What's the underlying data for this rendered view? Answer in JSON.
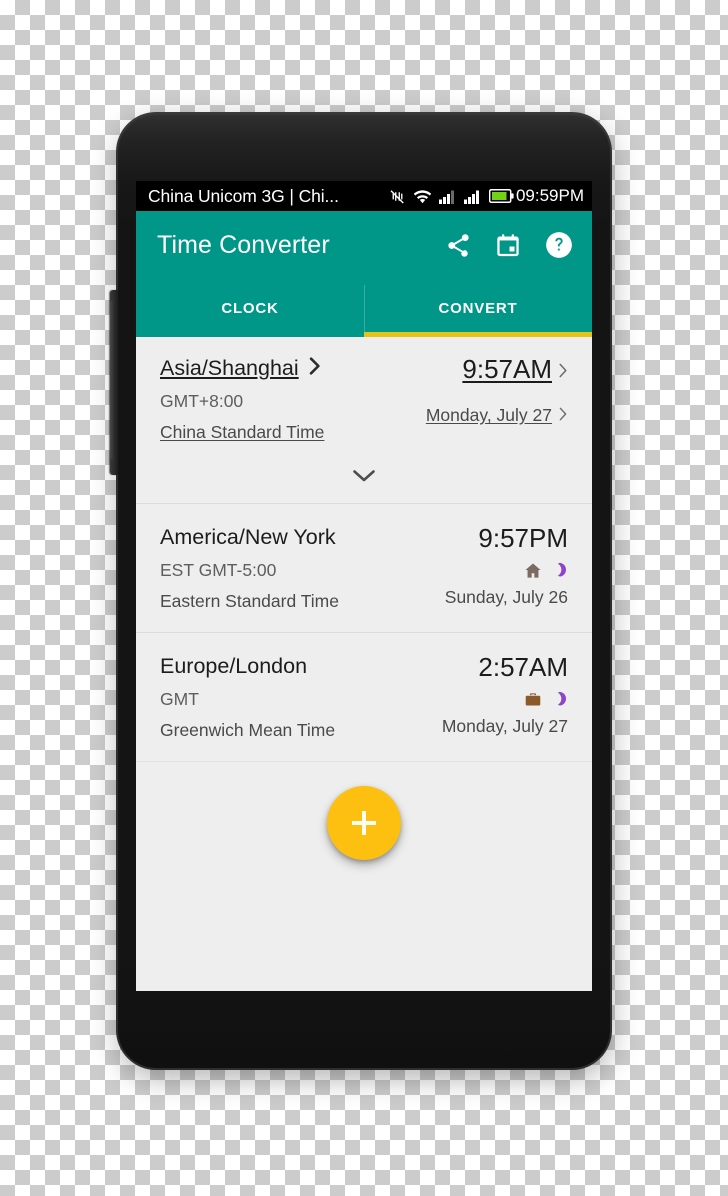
{
  "status_bar": {
    "carrier": "China Unicom 3G | Chi...",
    "clock": "09:59PM",
    "icons": [
      "vibrate-off-icon",
      "wifi-icon",
      "signal-icon",
      "signal-icon",
      "battery-icon"
    ]
  },
  "app_bar": {
    "title": "Time Converter",
    "actions": [
      {
        "name": "share-icon",
        "label": "Share"
      },
      {
        "name": "calendar-icon",
        "label": "Calendar"
      },
      {
        "name": "help-icon",
        "label": "Help"
      }
    ]
  },
  "tabs": {
    "items": [
      {
        "label": "CLOCK",
        "selected": false
      },
      {
        "label": "CONVERT",
        "selected": true
      }
    ],
    "indicator_color": "#e8c317"
  },
  "timezones": [
    {
      "name": "Asia/Shanghai",
      "offset": "GMT+8:00",
      "long_name": "China Standard Time",
      "time": "9:57AM",
      "date": "Monday, July 27",
      "badges": [],
      "editable": true
    },
    {
      "name": "America/New York",
      "offset": "EST GMT-5:00",
      "long_name": "Eastern Standard Time",
      "time": "9:57PM",
      "date": "Sunday, July 26",
      "badges": [
        "home-icon",
        "moon-icon"
      ],
      "editable": false
    },
    {
      "name": "Europe/London",
      "offset": "GMT",
      "long_name": "Greenwich Mean Time",
      "time": "2:57AM",
      "date": "Monday, July 27",
      "badges": [
        "briefcase-icon",
        "moon-icon"
      ],
      "editable": false
    }
  ],
  "expander": {
    "name": "expand-chevron-icon"
  },
  "fab": {
    "name": "add-timezone-button",
    "label": "+"
  },
  "colors": {
    "accent_teal": "#009688",
    "indicator_yellow": "#e8c317",
    "fab_amber": "#fdc010",
    "moon_purple": "#8e44c9",
    "briefcase_brown": "#8a5a2b",
    "home_gray": "#7a6a62",
    "screen_bg": "#eeeeee",
    "battery_green": "#73d216"
  }
}
